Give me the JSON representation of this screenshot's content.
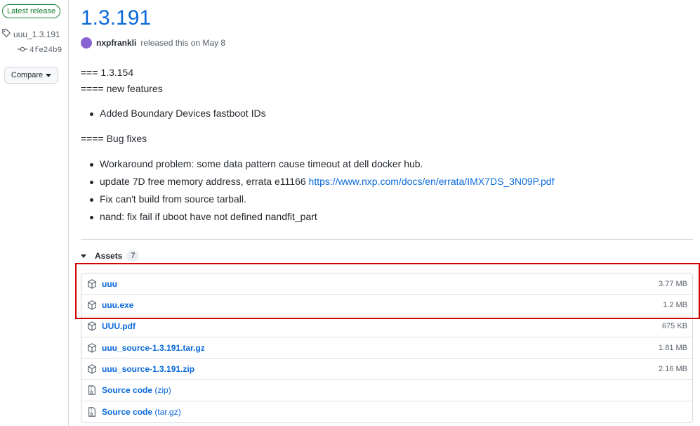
{
  "sidebar": {
    "latest_badge": "Latest release",
    "tag": "uuu_1.3.191",
    "commit": "4fe24b9",
    "compare_label": "Compare"
  },
  "release": {
    "title": "1.3.191",
    "author": "nxpfrankli",
    "released_text": "released this on May 8"
  },
  "notes": {
    "heading1": "=== 1.3.154",
    "heading2": "==== new features",
    "features": [
      "Added Boundary Devices fastboot IDs"
    ],
    "heading3": "==== Bug fixes",
    "fixes": [
      "Workaround problem: some data pattern cause timeout at dell docker hub.",
      "update 7D free memory address, errata e11166 ",
      "Fix can't build from source tarball.",
      "nand: fix fail if uboot have not defined nandfit_part"
    ],
    "fix_link": "https://www.nxp.com/docs/en/errata/IMX7DS_3N09P.pdf"
  },
  "assets": {
    "label": "Assets",
    "count": "7",
    "items": [
      {
        "name": "uuu",
        "size": "3.77 MB",
        "icon": "package-icon"
      },
      {
        "name": "uuu.exe",
        "size": "1.2 MB",
        "icon": "package-icon"
      },
      {
        "name": "UUU.pdf",
        "size": "675 KB",
        "icon": "package-icon"
      },
      {
        "name": "uuu_source-1.3.191.tar.gz",
        "size": "1.81 MB",
        "icon": "package-icon"
      },
      {
        "name": "uuu_source-1.3.191.zip",
        "size": "2.16 MB",
        "icon": "package-icon"
      },
      {
        "name": "Source code",
        "suffix": "(zip)",
        "size": "",
        "icon": "file-zip-icon"
      },
      {
        "name": "Source code",
        "suffix": "(tar.gz)",
        "size": "",
        "icon": "file-zip-icon"
      }
    ]
  },
  "colors": {
    "link": "#0969da",
    "success": "#1a7f37",
    "highlight": "#d00000"
  }
}
